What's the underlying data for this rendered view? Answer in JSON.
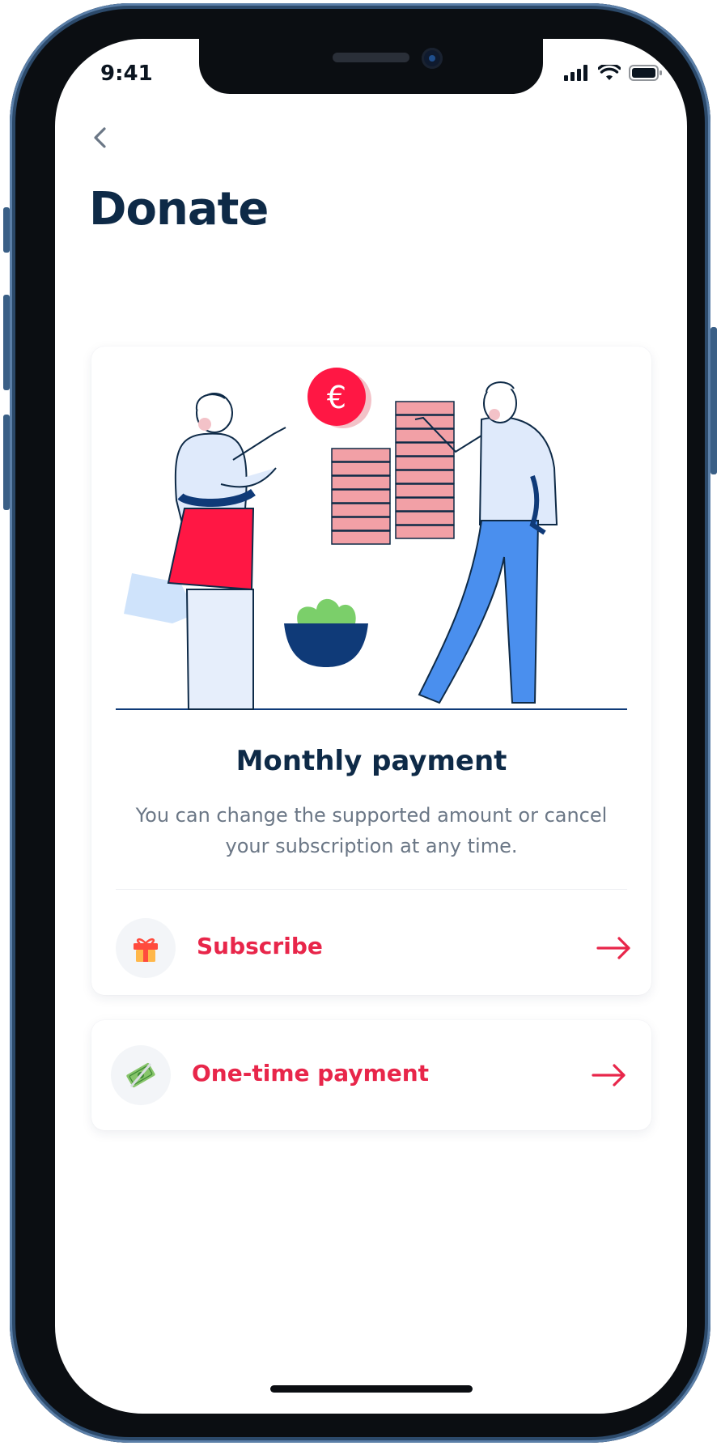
{
  "status_bar": {
    "time": "9:41"
  },
  "nav": {
    "back_icon": "chevron-left-icon"
  },
  "page": {
    "title": "Donate"
  },
  "monthly_card": {
    "illustration_badge": "€",
    "title": "Monthly payment",
    "description": "You can change the supported amount or cancel your subscription at any time.",
    "action": {
      "icon": "gift-icon",
      "label": "Subscribe",
      "arrow_icon": "arrow-right-icon"
    }
  },
  "one_time_card": {
    "action": {
      "icon": "money-icon",
      "label": "One-time payment",
      "arrow_icon": "arrow-right-icon"
    }
  },
  "colors": {
    "accent": "#e8264a",
    "title": "#0e2a47",
    "body_text": "#6b7786",
    "blue": "#4a8fee",
    "navy": "#0f3a78"
  }
}
